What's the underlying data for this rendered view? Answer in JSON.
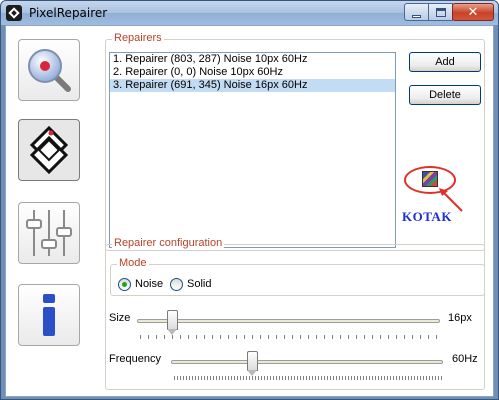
{
  "window": {
    "title": "PixelRepairer"
  },
  "title_buttons": {
    "minimize": "minimize-icon",
    "maximize": "maximize-icon",
    "close_glyph": "✕"
  },
  "nav": [
    {
      "icon": "magnifier-icon",
      "selected": false
    },
    {
      "icon": "repair-diamond-icon",
      "selected": true
    },
    {
      "icon": "sliders-icon",
      "selected": false
    },
    {
      "icon": "info-icon",
      "selected": false
    }
  ],
  "repairers": {
    "group_title": "Repairers",
    "items": [
      "1. Repairer (803, 287) Noise 10px 60Hz",
      "2. Repairer (0, 0) Noise 10px 60Hz",
      "3. Repairer (691, 345) Noise 16px 60Hz"
    ],
    "selected_index": 2,
    "add_label": "Add",
    "delete_label": "Delete"
  },
  "annotation": {
    "text": "KOTAK",
    "color": "#1b2fd4",
    "ring_color": "#e0302a"
  },
  "config": {
    "group_title": "Repairer configuration",
    "mode": {
      "title": "Mode",
      "options": [
        "Noise",
        "Solid"
      ],
      "selected": "Noise"
    },
    "size": {
      "label": "Size",
      "value_text": "16px",
      "position": 0.1
    },
    "frequency": {
      "label": "Frequency",
      "value_text": "60Hz",
      "position": 0.3
    }
  },
  "colors": {
    "group_title": "#b5442a",
    "selection": "#c2dcf3"
  }
}
